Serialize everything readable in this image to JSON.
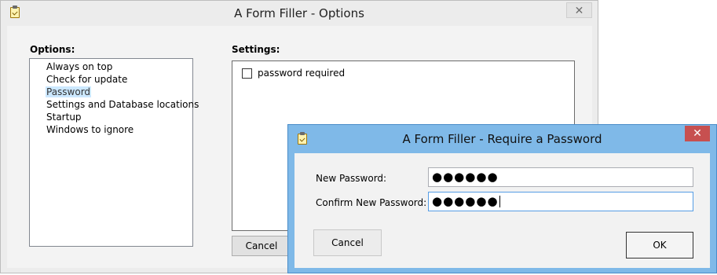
{
  "options_window": {
    "title": "A Form Filler  - Options",
    "close_glyph": "✕",
    "options_group": {
      "label": "Options:",
      "items": [
        {
          "label": "Always on top",
          "selected": false
        },
        {
          "label": "Check for update",
          "selected": false
        },
        {
          "label": "Password",
          "selected": true
        },
        {
          "label": "Settings and Database locations",
          "selected": false
        },
        {
          "label": "Startup",
          "selected": false
        },
        {
          "label": "Windows to ignore",
          "selected": false
        }
      ]
    },
    "settings_group": {
      "label": "Settings:",
      "password_required": {
        "label": "password required",
        "checked": false
      }
    },
    "cancel_label": "Cancel"
  },
  "password_dialog": {
    "title": "A Form Filler - Require a Password",
    "close_glyph": "✕",
    "new_password": {
      "label": "New Password:",
      "value": "●●●●●●"
    },
    "confirm_password": {
      "label": "Confirm New Password:",
      "value": "●●●●●●"
    },
    "cancel_label": "Cancel",
    "ok_label": "OK"
  },
  "icons": {
    "app": "clipboard-check-icon",
    "close": "close-icon"
  },
  "colors": {
    "dialog_frame": "#7fb9e8",
    "close_button_active": "#c75050",
    "selection": "#cce8ff",
    "focus_border": "#569de5"
  }
}
